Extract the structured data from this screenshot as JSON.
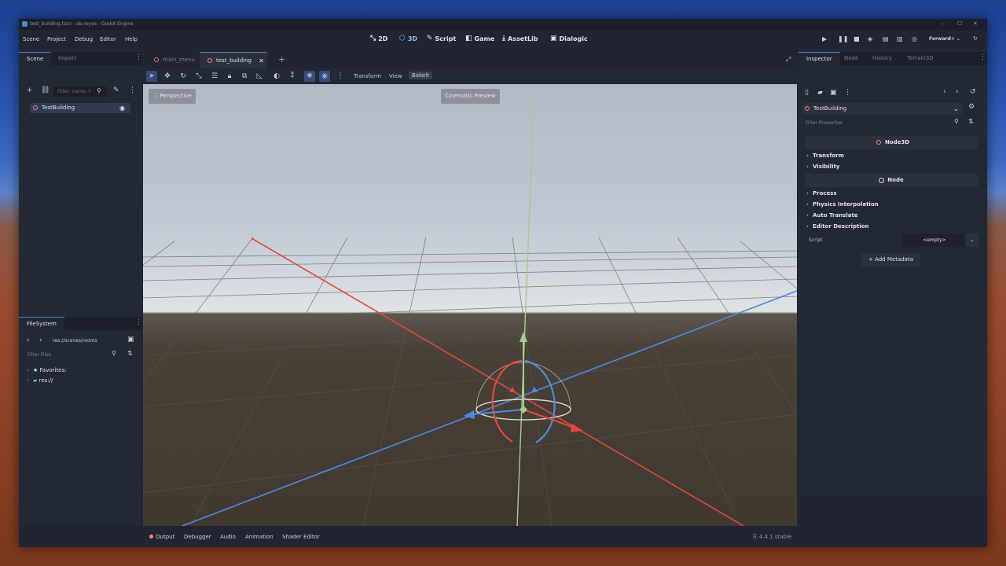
{
  "window": {
    "title": "test_building.tscn - de-reyes - Godot Engine"
  },
  "menu": [
    "Scene",
    "Project",
    "Debug",
    "Editor",
    "Help"
  ],
  "workspaces": [
    {
      "label": "2D",
      "icon": "2d-icon"
    },
    {
      "label": "3D",
      "icon": "3d-icon"
    },
    {
      "label": "Script",
      "icon": "script-icon"
    },
    {
      "label": "Game",
      "icon": "game-icon"
    },
    {
      "label": "AssetLib",
      "icon": "assetlib-icon"
    },
    {
      "label": "Dialogic",
      "icon": "dialogic-icon"
    }
  ],
  "renderer": "Forward+",
  "scene_dock": {
    "tabs": [
      "Scene",
      "Import"
    ],
    "filter_placeholder": "Filter: name, t",
    "root_node": "TestBuilding"
  },
  "filesystem_dock": {
    "title": "FileSystem",
    "path": "res://scenes/rooms",
    "filter_placeholder": "Filter Files",
    "items": [
      "Favorites:",
      "res://"
    ]
  },
  "editor_tabs": [
    "main_menu",
    "test_building"
  ],
  "toolbar": {
    "transform": "Transform",
    "view": "View",
    "bakelt": "Bakelt"
  },
  "viewport": {
    "perspective": "Perspective",
    "cinematic": "Cinematic Preview"
  },
  "bottom_panel": [
    "Output",
    "Debugger",
    "Audio",
    "Animation",
    "Shader Editor"
  ],
  "version": "4.4.1.stable",
  "inspector": {
    "tabs": [
      "Inspector",
      "Node",
      "History",
      "Terrain3D"
    ],
    "selected_node": "TestBuilding",
    "filter_placeholder": "Filter Properties",
    "sections": [
      {
        "title": "Node3D",
        "groups": [
          "Transform",
          "Visibility"
        ]
      },
      {
        "title": "Node",
        "groups": [
          "Process",
          "Physics Interpolation",
          "Auto Translate",
          "Editor Description"
        ]
      }
    ],
    "script_label": "Script",
    "script_value": "<empty>",
    "add_metadata": "Add Metadata"
  },
  "colors": {
    "x_axis": "#e5473c",
    "y_axis": "#9fcf8a",
    "z_axis": "#4b8be0",
    "accent": "#4f7fc9"
  }
}
